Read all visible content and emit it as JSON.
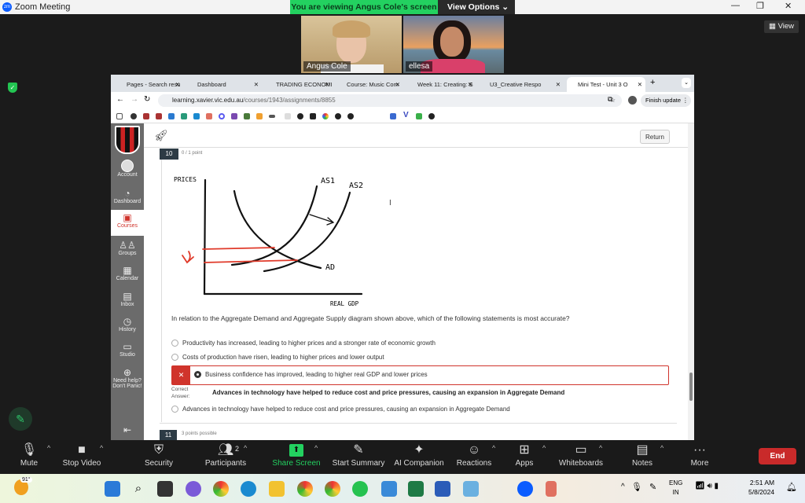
{
  "window": {
    "title": "Zoom Meeting",
    "logo": "zm"
  },
  "banner": {
    "text": "You are viewing Angus Cole's screen",
    "view_options": "View Options"
  },
  "participants": [
    {
      "name": "Angus Cole"
    },
    {
      "name": "ellesa"
    }
  ],
  "view_button": "View",
  "browser": {
    "tabs": [
      {
        "label": "Pages - Search resu"
      },
      {
        "label": "Dashboard"
      },
      {
        "label": "TRADING ECONOMI"
      },
      {
        "label": "Course: Music Com"
      },
      {
        "label": "Week 11: Creating: S"
      },
      {
        "label": "U3_Creative Respo"
      },
      {
        "label": "Mini Test - Unit 3 O"
      }
    ],
    "url_host": "learning.xavier.vic.edu.au",
    "url_path": "/courses/1943/assignments/8855",
    "finish_update": "Finish update"
  },
  "sidebar": {
    "items": [
      {
        "label": "Account",
        "icon": "avatar"
      },
      {
        "label": "Dashboard",
        "icon": "dashboard-icon"
      },
      {
        "label": "Courses",
        "icon": "book-icon",
        "active": true
      },
      {
        "label": "Groups",
        "icon": "groups-icon"
      },
      {
        "label": "Calendar",
        "icon": "calendar-icon"
      },
      {
        "label": "Inbox",
        "icon": "inbox-icon"
      },
      {
        "label": "History",
        "icon": "clock-icon"
      },
      {
        "label": "Studio",
        "icon": "studio-icon"
      },
      {
        "label": "Need help? Don't Panic!",
        "icon": "lifebuoy-icon"
      }
    ]
  },
  "content": {
    "return": "Return",
    "question": {
      "number": "10",
      "points": "0 / 1 point",
      "diagram": {
        "ylabel": "PRICES",
        "xlabel": "REAL GDP",
        "curves": [
          "AS1",
          "AS2",
          "AD"
        ]
      },
      "text": "In relation to the Aggregate Demand and Aggregate Supply diagram shown above, which of the following statements is most accurate?",
      "options": [
        "Productivity has increased, leading to higher prices and a stronger rate of economic growth",
        "Costs of production have risen, leading to higher prices and lower output",
        "Business confidence has improved, leading to higher real GDP and lower prices",
        "Advances in technology have helped to reduce cost and price pressures, causing an expansion in Aggregate Demand"
      ],
      "selected_index": 2,
      "selected_correct": false,
      "correct_label": "Correct Answer:",
      "correct_answer": "Advances in technology have helped to reduce cost and price pressures, causing an expansion in Aggregate Demand"
    },
    "next": {
      "number": "11",
      "points": "3 points possible"
    }
  },
  "toolbar": {
    "items": [
      {
        "label": "Mute",
        "icon": "mic-icon"
      },
      {
        "label": "Stop Video",
        "icon": "video-icon"
      },
      {
        "label": "Security",
        "icon": "shield-icon"
      },
      {
        "label": "Participants",
        "icon": "participants-icon",
        "count": "2"
      },
      {
        "label": "Share Screen",
        "icon": "share-icon"
      },
      {
        "label": "Start Summary",
        "icon": "summary-icon"
      },
      {
        "label": "AI Companion",
        "icon": "sparkle-icon"
      },
      {
        "label": "Reactions",
        "icon": "emoji-icon"
      },
      {
        "label": "Apps",
        "icon": "apps-icon"
      },
      {
        "label": "Whiteboards",
        "icon": "whiteboard-icon"
      },
      {
        "label": "Notes",
        "icon": "notes-icon"
      },
      {
        "label": "More",
        "icon": "more-icon"
      }
    ],
    "end": "End",
    "share_color": "#23d160",
    "end_color": "#c92a2a"
  },
  "taskbar": {
    "weather": "91°",
    "lang1": "ENG",
    "lang2": "IN",
    "time": "2:51 AM",
    "date": "5/8/2024"
  }
}
